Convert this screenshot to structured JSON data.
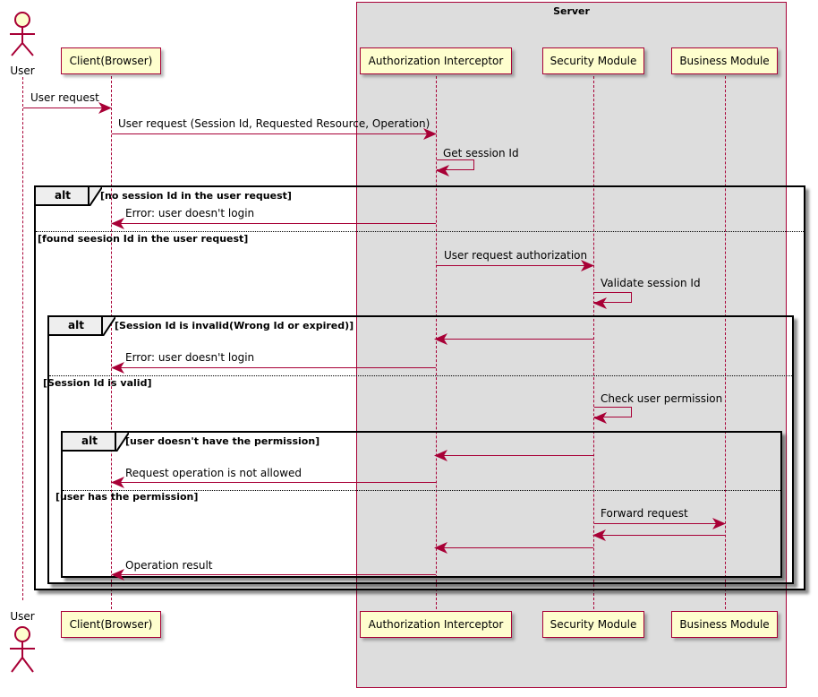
{
  "diagram": {
    "type": "uml-sequence-diagram",
    "colors": {
      "line": "#A80036",
      "participant_fill": "#FEFECE",
      "group_fill": "#DDDDDD",
      "fragment_tab_fill": "#EEEEEE",
      "text": "#000000"
    }
  },
  "group": {
    "title": "Server"
  },
  "actor": {
    "name": "User",
    "name_bottom": "User"
  },
  "participants": [
    {
      "id": "client",
      "label": "Client(Browser)"
    },
    {
      "id": "interceptor",
      "label": "Authorization Interceptor"
    },
    {
      "id": "security",
      "label": "Security Module"
    },
    {
      "id": "business",
      "label": "Business Module"
    }
  ],
  "participants_bottom": [
    {
      "id": "client",
      "label": "Client(Browser)"
    },
    {
      "id": "interceptor",
      "label": "Authorization Interceptor"
    },
    {
      "id": "security",
      "label": "Security Module"
    },
    {
      "id": "business",
      "label": "Business Module"
    }
  ],
  "messages": [
    {
      "id": "m1",
      "label": "User request",
      "from": "user",
      "to": "client",
      "direction": "right"
    },
    {
      "id": "m2",
      "label": "User request (Session Id, Requested Resource, Operation)",
      "from": "client",
      "to": "interceptor",
      "direction": "right"
    },
    {
      "id": "m3",
      "label": "Get session Id",
      "from": "interceptor",
      "to": "interceptor",
      "direction": "self"
    },
    {
      "id": "m4",
      "label": "Error: user doesn't login",
      "from": "interceptor",
      "to": "client",
      "direction": "left"
    },
    {
      "id": "m5",
      "label": "User request authorization",
      "from": "interceptor",
      "to": "security",
      "direction": "right"
    },
    {
      "id": "m6",
      "label": "Validate session Id",
      "from": "security",
      "to": "security",
      "direction": "self"
    },
    {
      "id": "m7",
      "label": "",
      "from": "security",
      "to": "interceptor",
      "direction": "left"
    },
    {
      "id": "m8",
      "label": "Error: user doesn't login",
      "from": "interceptor",
      "to": "client",
      "direction": "left"
    },
    {
      "id": "m9",
      "label": "Check user permission",
      "from": "security",
      "to": "security",
      "direction": "self"
    },
    {
      "id": "m10",
      "label": "",
      "from": "security",
      "to": "interceptor",
      "direction": "left"
    },
    {
      "id": "m11",
      "label": "Request operation is not allowed",
      "from": "interceptor",
      "to": "client",
      "direction": "left"
    },
    {
      "id": "m12",
      "label": "Forward request",
      "from": "security",
      "to": "business",
      "direction": "right"
    },
    {
      "id": "m13",
      "label": "",
      "from": "business",
      "to": "security",
      "direction": "left"
    },
    {
      "id": "m14",
      "label": "",
      "from": "security",
      "to": "interceptor",
      "direction": "left"
    },
    {
      "id": "m15",
      "label": "Operation result",
      "from": "interceptor",
      "to": "client",
      "direction": "left"
    }
  ],
  "fragments": [
    {
      "id": "alt1",
      "label": "alt",
      "conditions": [
        "[no session Id in the user request]",
        "[found seesion Id in the user request]"
      ]
    },
    {
      "id": "alt2",
      "label": "alt",
      "conditions": [
        "[Session Id is invalid(Wrong Id or expired)]",
        "[Session Id is valid]"
      ]
    },
    {
      "id": "alt3",
      "label": "alt",
      "conditions": [
        "[user doesn't have the permission]",
        "[user has the permission]"
      ]
    }
  ]
}
